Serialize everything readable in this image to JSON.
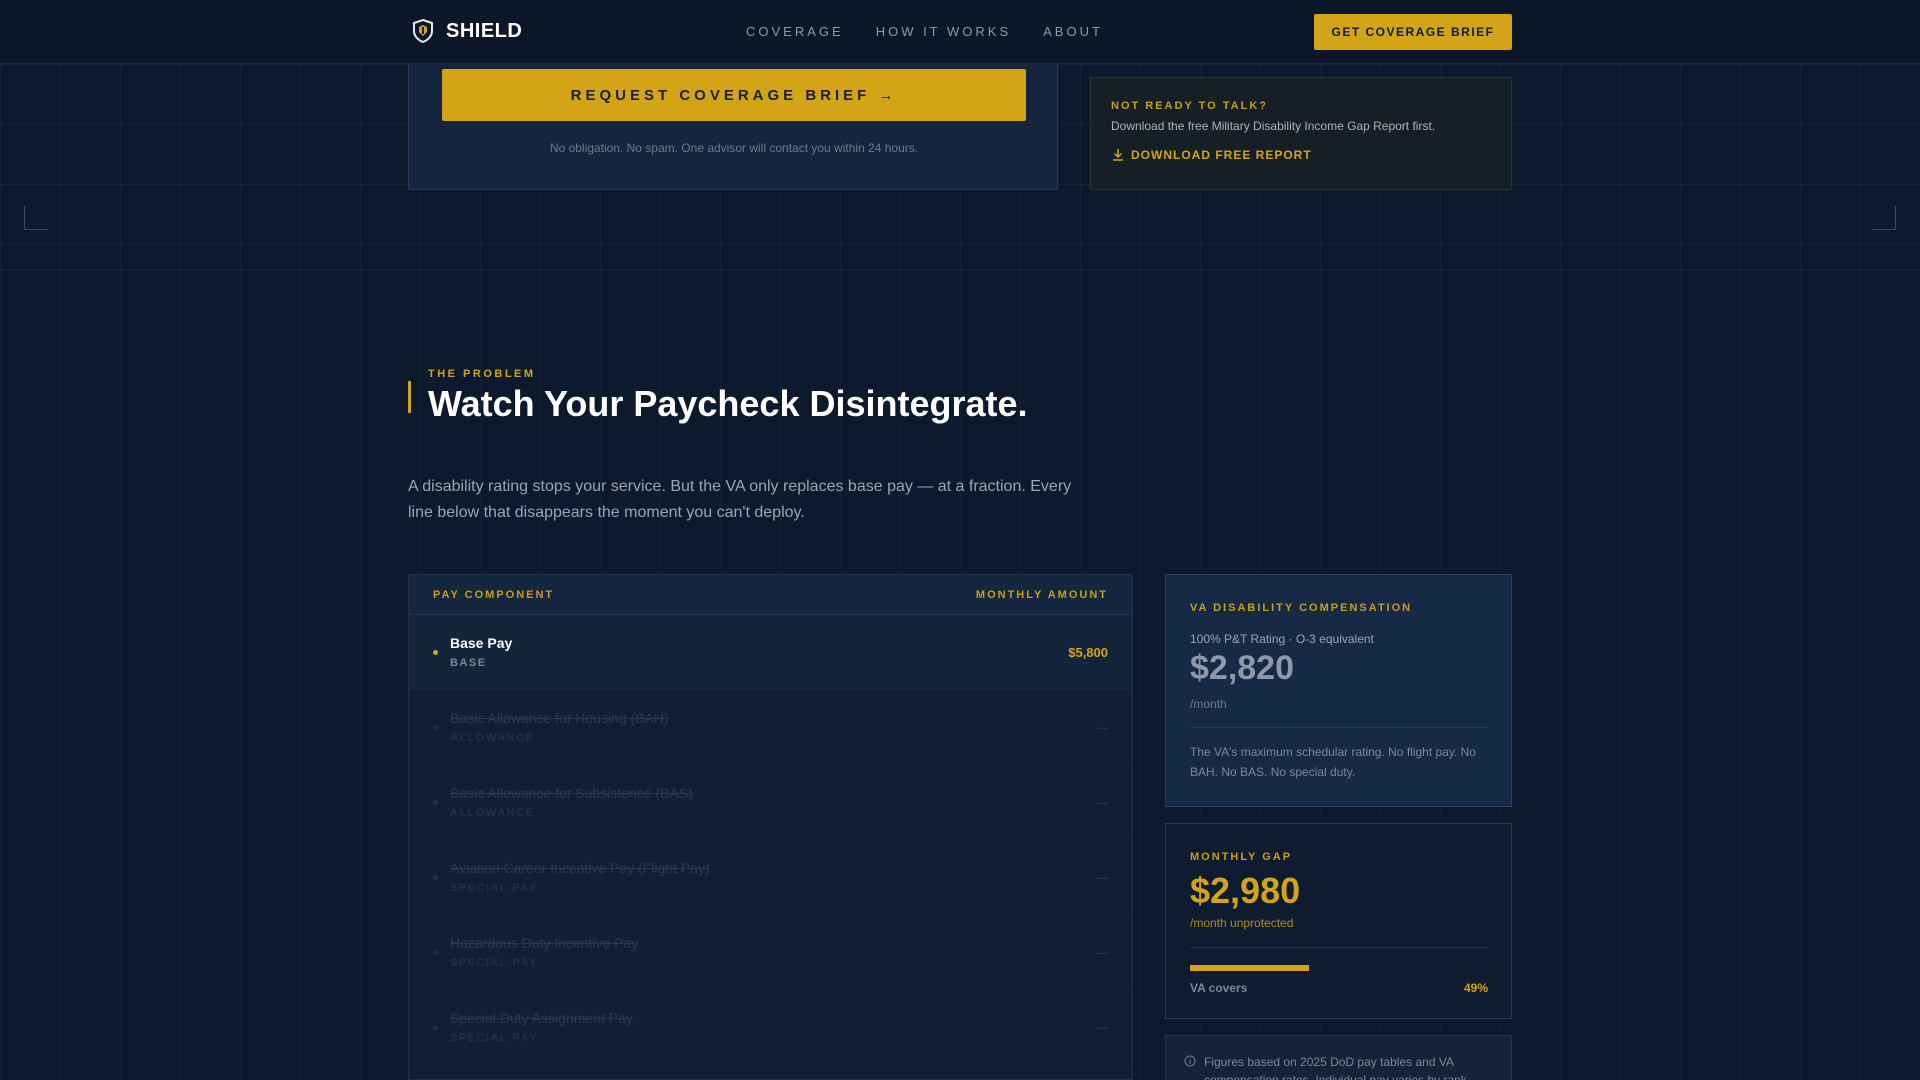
{
  "header": {
    "brand": "SHIELD",
    "nav": [
      "COVERAGE",
      "HOW IT WORKS",
      "ABOUT"
    ],
    "cta": "GET COVERAGE BRIEF"
  },
  "form_card": {
    "button_label": "REQUEST COVERAGE BRIEF",
    "button_arrow": "→",
    "note": "No obligation. No spam. One advisor will contact you within 24 hours."
  },
  "alt_card": {
    "kicker": "NOT READY TO TALK?",
    "text": "Download the free Military Disability Income Gap Report first.",
    "link": "DOWNLOAD FREE REPORT"
  },
  "problem": {
    "kicker": "THE PROBLEM",
    "headline": "Watch Your Paycheck Disintegrate.",
    "lead": "A disability rating stops your service. But the VA only replaces base pay — at a fraction. Every line below that disappears the moment you can't deploy."
  },
  "pay_table": {
    "headers": [
      "PAY COMPONENT",
      "MONTHLY AMOUNT"
    ],
    "rows": [
      {
        "name": "Base Pay",
        "type": "BASE",
        "amount": "$5,800"
      },
      {
        "name": "Basic Allowance for Housing (BAH)",
        "type": "ALLOWANCE",
        "amount": "—"
      },
      {
        "name": "Basic Allowance for Subsistence (BAS)",
        "type": "ALLOWANCE",
        "amount": "—"
      },
      {
        "name": "Aviation Career Incentive Pay (Flight Pay)",
        "type": "SPECIAL PAY",
        "amount": "—"
      },
      {
        "name": "Hazardous Duty Incentive Pay",
        "type": "SPECIAL PAY",
        "amount": "—"
      },
      {
        "name": "Special Duty Assignment Pay",
        "type": "SPECIAL PAY",
        "amount": "—"
      }
    ]
  },
  "va_card": {
    "kicker": "VA DISABILITY COMPENSATION",
    "sub": "100% P&T Rating · O-3 equivalent",
    "amount": "$2,820",
    "per": "/month",
    "desc": "The VA's maximum schedular rating. No flight pay. No BAH. No BAS. No special duty."
  },
  "gap_card": {
    "kicker": "MONTHLY GAP",
    "amount": "$2,980",
    "per": "/month unprotected",
    "bar_label": "VA covers",
    "bar_pct_label": "49%",
    "bar_fraction": 0.4
  },
  "footnote": {
    "text": "Figures based on 2025 DoD pay tables and VA compensation rates. Individual pay varies by rank"
  },
  "colors": {
    "accent": "#d4a418",
    "background": "#0d1a2e"
  }
}
